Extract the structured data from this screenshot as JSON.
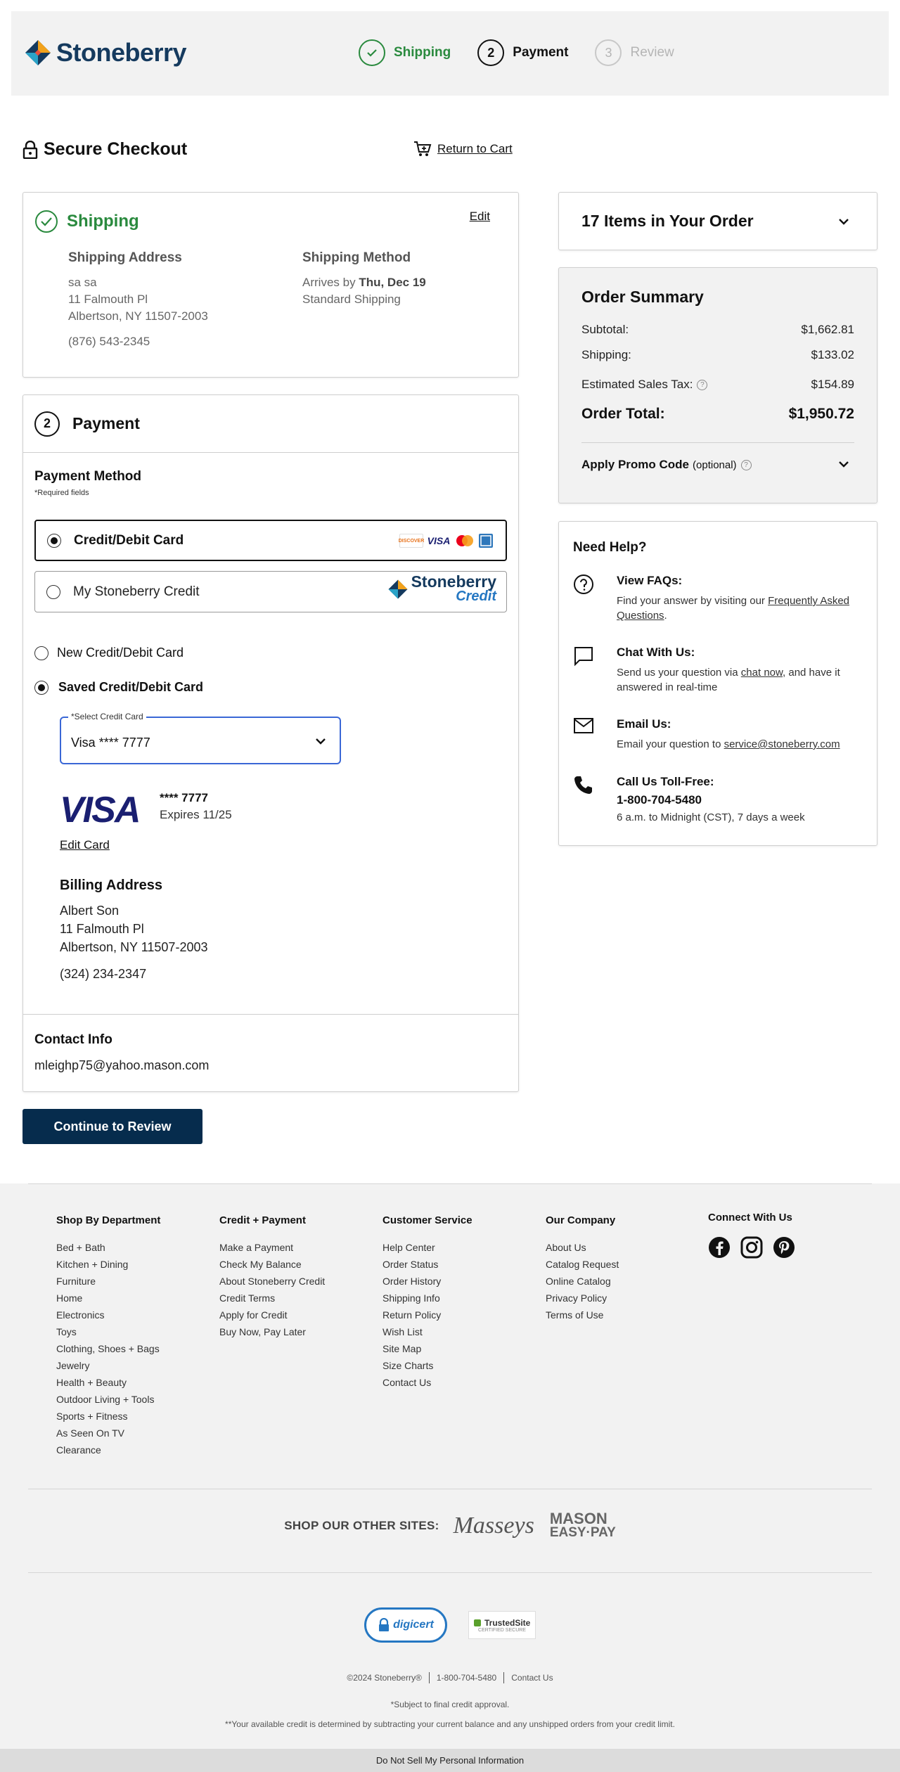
{
  "header": {
    "logo_text": "Stoneberry",
    "steps": [
      {
        "label": "Shipping",
        "num": "✓",
        "state": "done"
      },
      {
        "label": "Payment",
        "num": "2",
        "state": "current"
      },
      {
        "label": "Review",
        "num": "3",
        "state": "todo"
      }
    ]
  },
  "checkout": {
    "title": "Secure Checkout",
    "return_label": "Return to Cart"
  },
  "shipping": {
    "title": "Shipping",
    "edit_label": "Edit",
    "address_heading": "Shipping Address",
    "address_lines": [
      "sa sa",
      "11 Falmouth Pl",
      "Albertson, NY 11507-2003"
    ],
    "phone": "(876) 543-2345",
    "method_heading": "Shipping Method",
    "arrives_prefix": "Arrives by",
    "arrives_date": "Thu, Dec 19",
    "method_name": "Standard Shipping"
  },
  "payment": {
    "step_num": "2",
    "title": "Payment",
    "method_heading": "Payment Method",
    "required_note": "*Required fields",
    "option_card": "Credit/Debit Card",
    "option_credit": "My Stoneberry Credit",
    "credit_logo_a": "Stoneberry",
    "credit_logo_b": "Credit",
    "card_brands": [
      "DISCOVER",
      "VISA"
    ],
    "new_card_label": "New Credit/Debit Card",
    "saved_card_label": "Saved Credit/Debit Card",
    "select_label": "*Select Credit Card",
    "select_value": "Visa **** 7777",
    "card_brand_logo": "VISA",
    "card_masked": "**** 7777",
    "card_expiry": "Expires 11/25",
    "edit_card_label": "Edit Card",
    "billing_heading": "Billing Address",
    "billing_lines": [
      "Albert Son",
      "11 Falmouth Pl",
      "Albertson, NY 11507-2003"
    ],
    "billing_phone": "(324) 234-2347",
    "contact_heading": "Contact Info",
    "contact_email": "mleighp75@yahoo.mason.com",
    "continue_label": "Continue to Review"
  },
  "order": {
    "items_title": "17 Items in Your Order",
    "summary_title": "Order Summary",
    "subtotal_label": "Subtotal:",
    "subtotal_value": "$1,662.81",
    "shipping_label": "Shipping:",
    "shipping_value": "$133.02",
    "tax_label": "Estimated Sales Tax:",
    "tax_value": "$154.89",
    "total_label": "Order Total:",
    "total_value": "$1,950.72",
    "promo_label": "Apply Promo Code",
    "promo_optional": "(optional)"
  },
  "help": {
    "title": "Need Help?",
    "faq_heading": "View FAQs:",
    "faq_text": "Find your answer by visiting our",
    "faq_link": "Frequently Asked Questions",
    "chat_heading": "Chat With Us:",
    "chat_text_a": "Send us your question via",
    "chat_link": "chat now",
    "chat_text_b": ", and have it answered in real-time",
    "email_heading": "Email Us:",
    "email_text": "Email your question to",
    "email_link": "service@stoneberry.com",
    "call_heading": "Call Us Toll-Free:",
    "call_number": "1-800-704-5480",
    "call_hours": "6 a.m. to Midnight (CST), 7 days a week"
  },
  "footer": {
    "columns": [
      {
        "heading": "Shop By Department",
        "links": [
          "Bed + Bath",
          "Kitchen + Dining",
          "Furniture",
          "Home",
          "Electronics",
          "Toys",
          "Clothing, Shoes + Bags",
          "Jewelry",
          "Health + Beauty",
          "Outdoor Living + Tools",
          "Sports + Fitness",
          "As Seen On TV",
          "Clearance"
        ]
      },
      {
        "heading": "Credit + Payment",
        "links": [
          "Make a Payment",
          "Check My Balance",
          "About Stoneberry Credit",
          "Credit Terms",
          "Apply for Credit",
          "Buy Now, Pay Later"
        ]
      },
      {
        "heading": "Customer Service",
        "links": [
          "Help Center",
          "Order Status",
          "Order History",
          "Shipping Info",
          "Return Policy",
          "Wish List",
          "Site Map",
          "Size Charts",
          "Contact Us"
        ]
      },
      {
        "heading": "Our Company",
        "links": [
          "About Us",
          "Catalog Request",
          "Online Catalog",
          "Privacy Policy",
          "Terms of Use"
        ]
      }
    ],
    "connect_heading": "Connect With Us",
    "other_sites_label": "SHOP OUR OTHER SITES:",
    "masseys": "Masseys",
    "mason_a": "MASON",
    "mason_b": "EASY·PAY",
    "digicert": "digicert",
    "trusted_a": "TrustedSite",
    "trusted_b": "CERTIFIED SECURE",
    "copyright": "©2024 Stoneberry®",
    "phone": "1-800-704-5480",
    "contact": "Contact Us",
    "note1": "*Subject to final credit approval.",
    "note2": "**Your available credit is determined by subtracting your current balance and any unshipped orders from your credit limit.",
    "do_not_sell": "Do Not Sell My Personal Information"
  },
  "colors": {
    "brand_navy": "#153a5e",
    "success_green": "#2a8a3e",
    "button_navy": "#062c4d",
    "focus_blue": "#3a67d6"
  }
}
